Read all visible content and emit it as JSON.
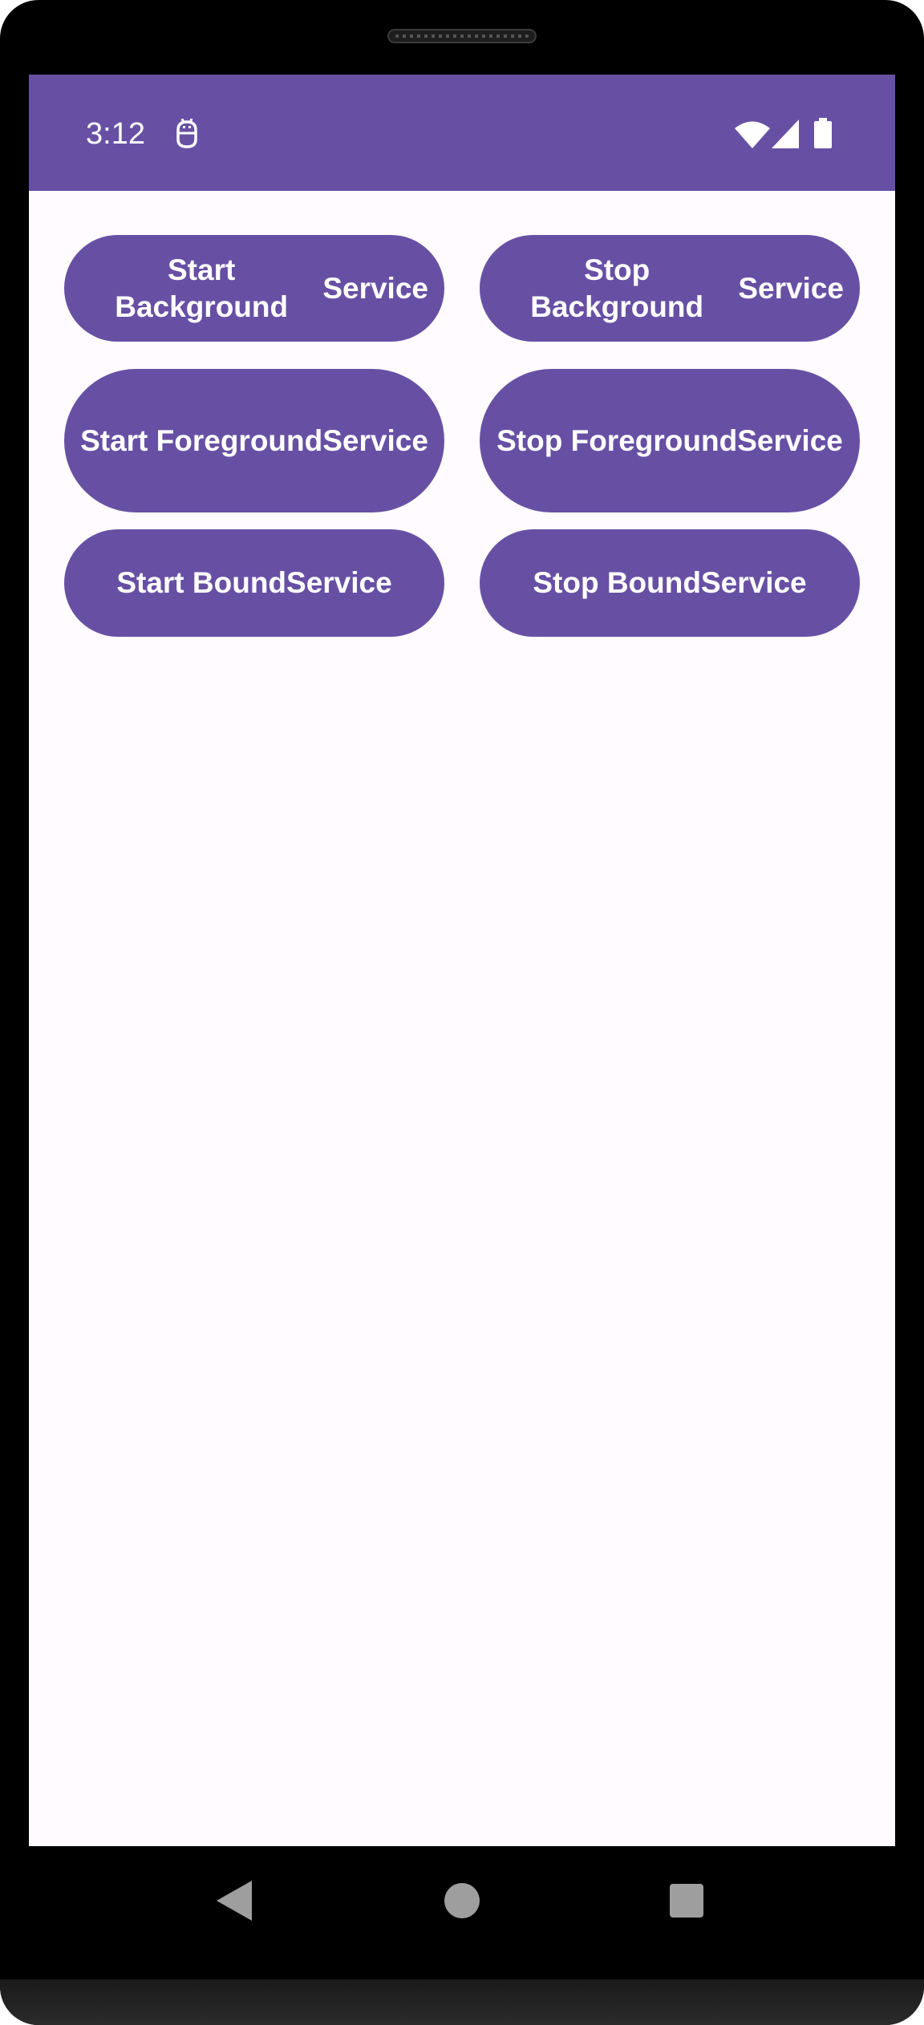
{
  "status_bar": {
    "time": "3:12",
    "icons": [
      "debug-icon",
      "wifi-icon",
      "cellular-signal-icon",
      "battery-icon"
    ],
    "background_color": "#6750a4"
  },
  "buttons": {
    "start_background": {
      "line1": "Start Background",
      "line2": "Service"
    },
    "stop_background": {
      "line1": "Stop Background",
      "line2": "Service"
    },
    "start_foreground": {
      "line1": "Start Foreground",
      "line2": "Service"
    },
    "stop_foreground": {
      "line1": "Stop Foreground",
      "line2": "Service"
    },
    "start_bound": {
      "line1": "Start Bound",
      "line2": "Service"
    },
    "stop_bound": {
      "line1": "Stop Bound",
      "line2": "Service"
    }
  },
  "navigation_bar": {
    "icons": [
      "back-icon",
      "home-icon",
      "recents-icon"
    ]
  },
  "colors": {
    "primary": "#6750a4",
    "surface": "#fffbfe",
    "on_primary": "#ffffff",
    "nav_icon": "#9e9e9e"
  }
}
